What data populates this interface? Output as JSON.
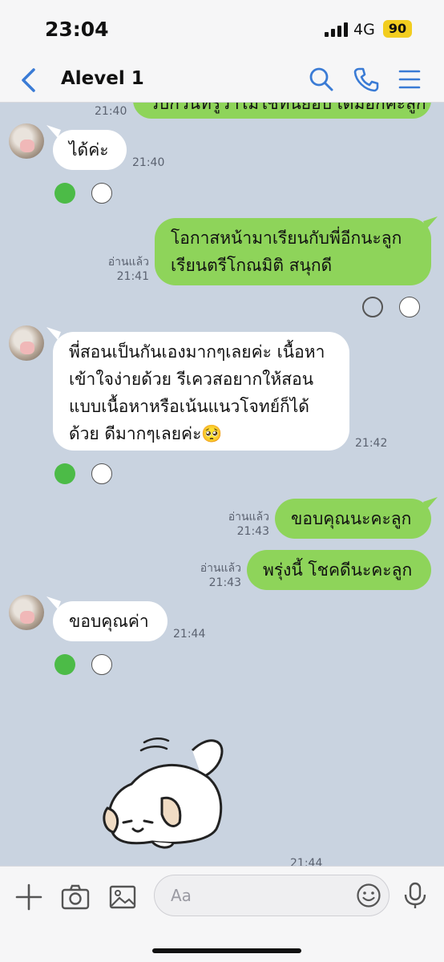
{
  "status": {
    "time": "23:04",
    "network": "4G",
    "battery": "90"
  },
  "header": {
    "title": "Alevel 1"
  },
  "messages": {
    "m0_partial": {
      "text": "วิบักวันที่รู้ว่าไม่ใช่ที่นี่ยอบ เดิมอีกคะลูก",
      "time": "21:40"
    },
    "m1": {
      "text": "ได้ค่ะ",
      "time": "21:40"
    },
    "m2": {
      "line1": "โอกาสหน้ามาเรียนกับพี่อีกนะลูก",
      "line2": "เรียนตรีโกณมิติ สนุกดี",
      "read": "อ่านแล้ว",
      "time": "21:41"
    },
    "m3": {
      "line1": "พี่สอนเป็นกันเองมากๆเลยค่ะ เนื้อหา",
      "line2": "เข้าใจง่ายด้วย รีเควสอยากให้สอน",
      "line3": "แบบเนื้อหาหรือเน้นแนวโจทย์ก็ได้",
      "line4": "ด้วย ดีมากๆเลยค่ะ🥺",
      "time": "21:42"
    },
    "m4": {
      "text": "ขอบคุณนะคะลูก",
      "read": "อ่านแล้ว",
      "time": "21:43"
    },
    "m5": {
      "text": "พรุ่งนี้ โชคดีนะคะลูก",
      "read": "อ่านแล้ว",
      "time": "21:43"
    },
    "m6": {
      "text": "ขอบคุณค่า",
      "time": "21:44"
    },
    "m7_sticker": {
      "time": "21:44"
    }
  },
  "input": {
    "placeholder": "Aa"
  },
  "icons": {
    "header": [
      "back-arrow-icon",
      "search-icon",
      "phone-icon",
      "menu-icon"
    ],
    "inputbar": [
      "plus-icon",
      "camera-icon",
      "image-icon",
      "emoji-icon",
      "microphone-icon"
    ]
  },
  "colors": {
    "accent": "#3a7bd5",
    "out_bubble": "#8ed45a",
    "in_bubble": "#ffffff",
    "chat_bg": "#c9d3e0"
  }
}
